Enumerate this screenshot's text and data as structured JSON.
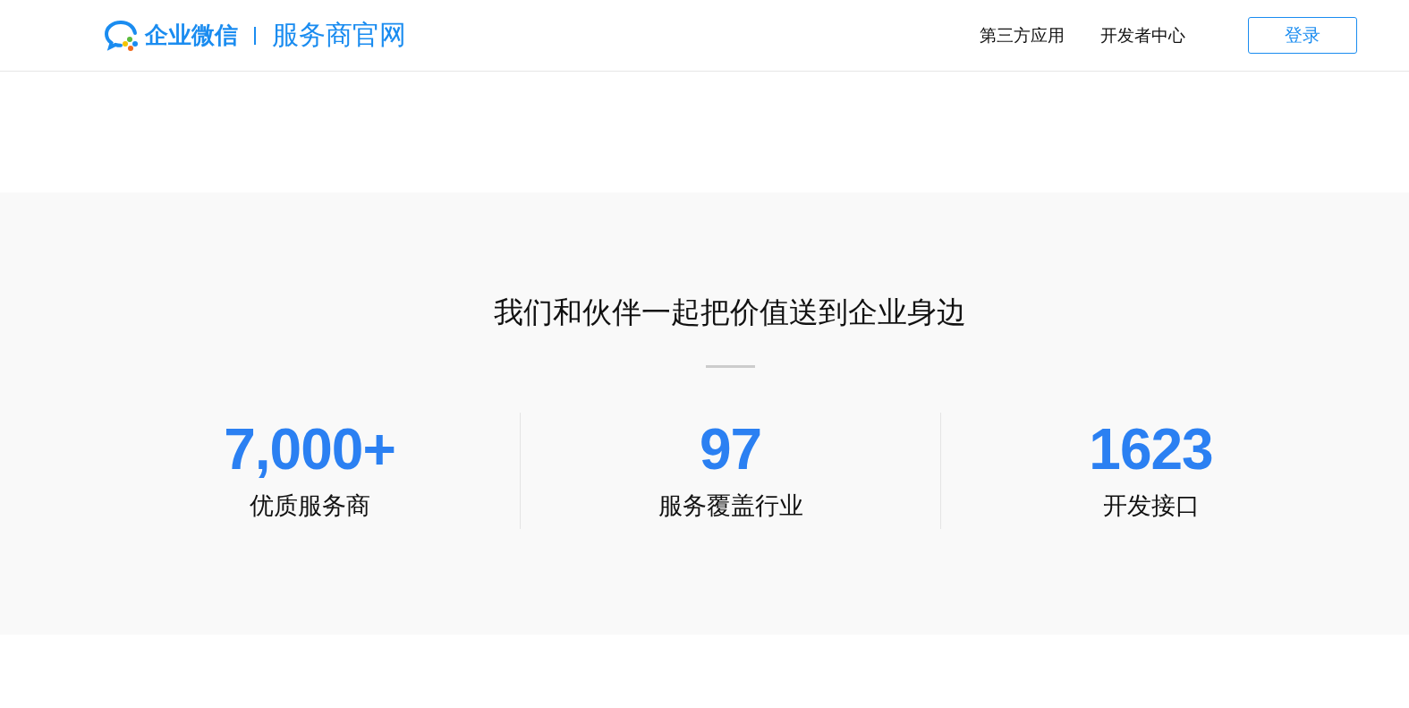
{
  "header": {
    "brand": "企业微信",
    "site": "服务商官网",
    "nav": [
      {
        "label": "第三方应用"
      },
      {
        "label": "开发者中心"
      }
    ],
    "login_button": "登录"
  },
  "partners": {
    "title": "我们和伙伴一起把价值送到企业身边",
    "stats": [
      {
        "value": "7,000+",
        "label": "优质服务商"
      },
      {
        "value": "97",
        "label": "服务覆盖行业"
      },
      {
        "value": "1623",
        "label": "开发接口"
      }
    ]
  }
}
